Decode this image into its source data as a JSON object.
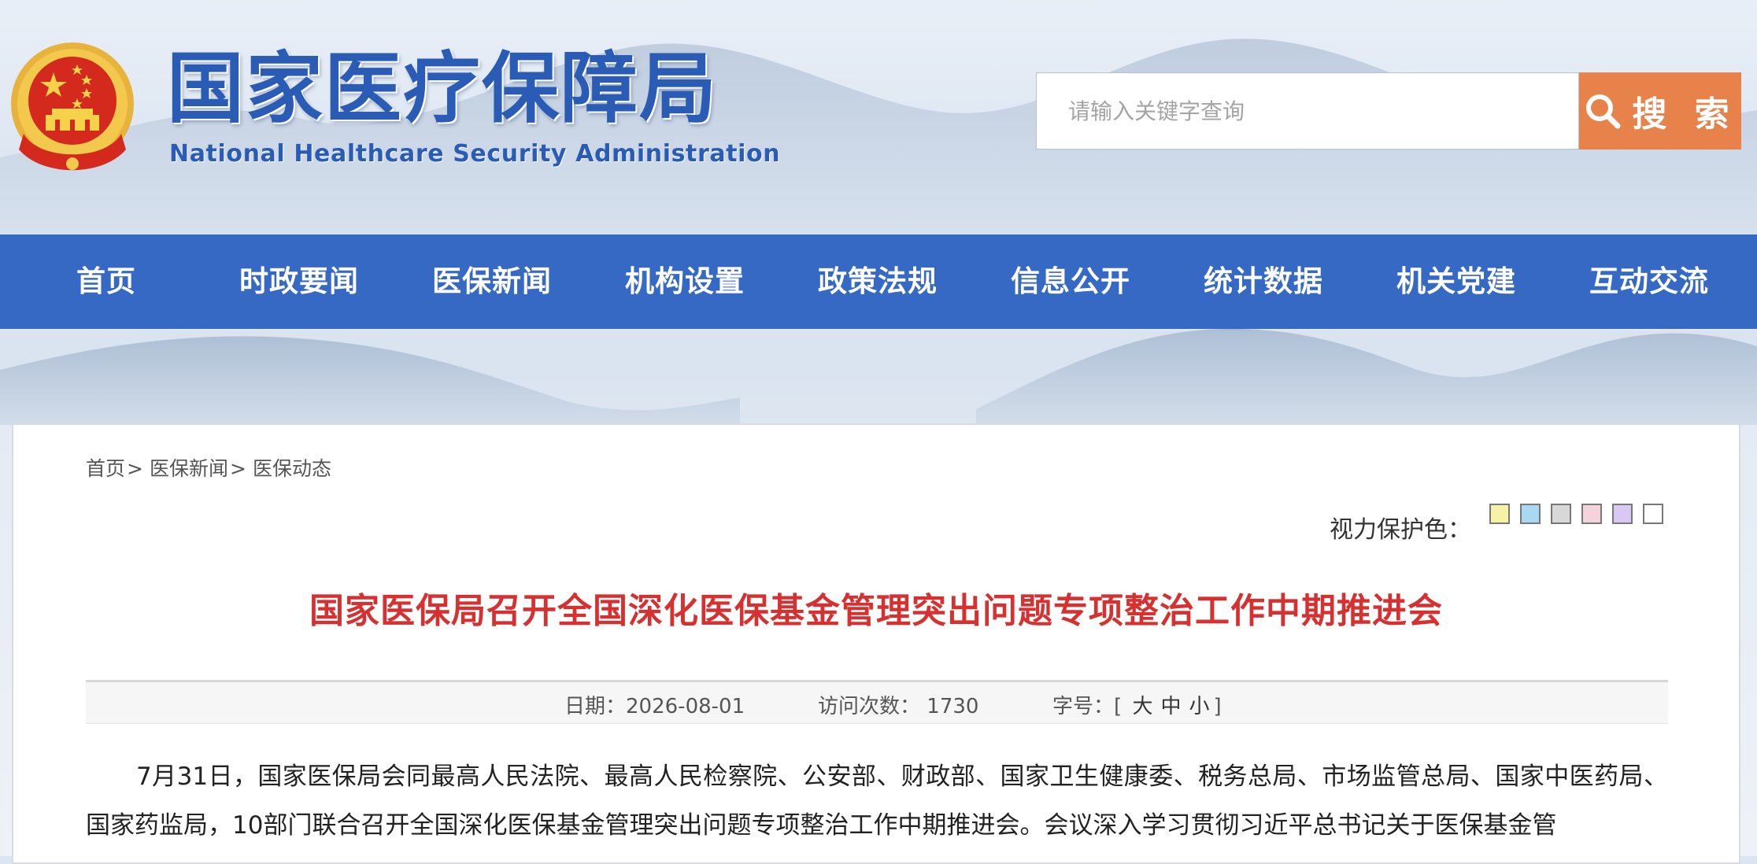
{
  "header": {
    "title": "国家医疗保障局",
    "subtitle": "National Healthcare Security Administration",
    "search_placeholder": "请输入关键字查询",
    "search_button": "搜 索"
  },
  "colors": {
    "nav_bg": "#3669c3",
    "title_blue": "#2a5bb5",
    "search_button": "#e6824a",
    "article_title": "#d63030"
  },
  "nav": [
    {
      "label": "首页"
    },
    {
      "label": "时政要闻"
    },
    {
      "label": "医保新闻"
    },
    {
      "label": "机构设置"
    },
    {
      "label": "政策法规"
    },
    {
      "label": "信息公开"
    },
    {
      "label": "统计数据"
    },
    {
      "label": "机关党建"
    },
    {
      "label": "互动交流"
    }
  ],
  "breadcrumb": [
    {
      "label": "首页"
    },
    {
      "label": "医保新闻"
    },
    {
      "label": "医保动态"
    }
  ],
  "breadcrumb_sep": ">",
  "eye_protect": {
    "label": "视力保护色：",
    "swatches": [
      "#f7f3a6",
      "#a9d8f2",
      "#d8d8d8",
      "#f5d3dd",
      "#d9c8f2",
      "#ffffff"
    ]
  },
  "article": {
    "title": "国家医保局召开全国深化医保基金管理突出问题专项整治工作中期推进会",
    "date_label": "日期：",
    "date": "2026-08-01",
    "views_label": "访问次数：",
    "views": "1730",
    "fontsize_label": "字号：",
    "fontsize_open": "[",
    "fontsize_large": "大",
    "fontsize_medium": "中",
    "fontsize_small": "小",
    "fontsize_close": "]",
    "body": "7月31日，国家医保局会同最高人民法院、最高人民检察院、公安部、财政部、国家卫生健康委、税务总局、市场监管总局、国家中医药局、国家药监局，10部门联合召开全国深化医保基金管理突出问题专项整治工作中期推进会。会议深入学习贯彻习近平总书记关于医保基金管"
  }
}
